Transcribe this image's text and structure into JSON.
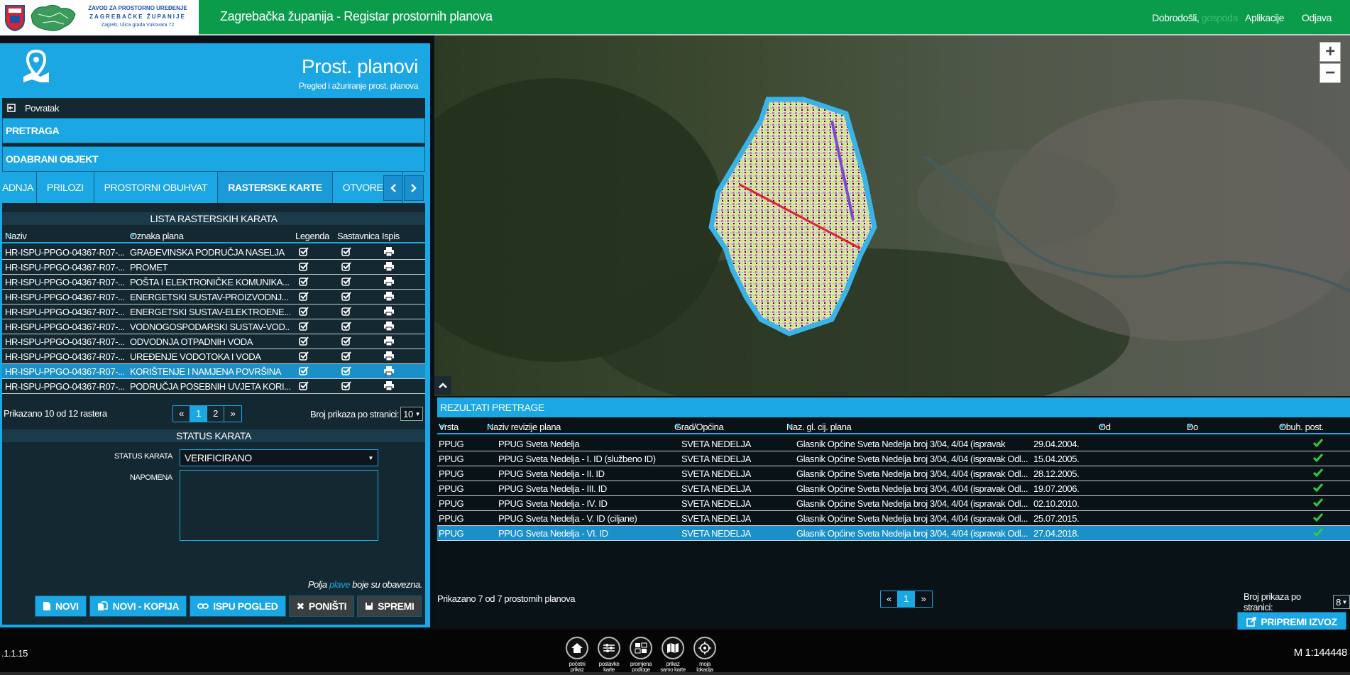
{
  "header": {
    "logo_line1": "ZAVOD ZA PROSTORNO UREĐENJE",
    "logo_line2": "ZAGREBAČKE ŽUPANIJE",
    "logo_line3": "Zagreb, Ulica grada Vukovara 72",
    "title": "Zagrebačka županija - Registar prostornih planova",
    "greeting": "Dobrodošli,",
    "user": "gospoda",
    "apps_link": "Aplikacije",
    "logout_link": "Odjava"
  },
  "left_panel": {
    "title": "Prost. planovi",
    "subtitle": "Pregled i ažuriranje prost. planova",
    "back_label": "Povratak",
    "search_section": "PRETRAGA",
    "selected_section": "ODABRANI OBJEKT",
    "tabs": [
      "ADNJA",
      "PRILOZI",
      "PROSTORNI OBUHVAT",
      "RASTERSKE KARTE",
      "OTVORENI"
    ],
    "active_tab": "RASTERSKE KARTE",
    "raster_list_title": "LISTA RASTERSKIH KARATA",
    "columns": [
      "Naziv",
      "Oznaka plana",
      "Legenda",
      "Sastavnica",
      "Ispis"
    ],
    "rows": [
      {
        "naziv": "HR-ISPU-PPGO-04367-R07-...",
        "oznaka": "GRAĐEVINSKA PODRUČJA NASELJA"
      },
      {
        "naziv": "HR-ISPU-PPGO-04367-R07-...",
        "oznaka": "PROMET"
      },
      {
        "naziv": "HR-ISPU-PPGO-04367-R07-...",
        "oznaka": "POŠTA I ELEKTRONIČKE KOMUNIKA..."
      },
      {
        "naziv": "HR-ISPU-PPGO-04367-R07-...",
        "oznaka": "ENERGETSKI SUSTAV-PROIZVODNJ..."
      },
      {
        "naziv": "HR-ISPU-PPGO-04367-R07-...",
        "oznaka": "ENERGETSKI SUSTAV-ELEKTROENE..."
      },
      {
        "naziv": "HR-ISPU-PPGO-04367-R07-...",
        "oznaka": "VODNOGOSPODARSKI SUSTAV-VOD..."
      },
      {
        "naziv": "HR-ISPU-PPGO-04367-R07-...",
        "oznaka": "ODVODNJA OTPADNIH VODA"
      },
      {
        "naziv": "HR-ISPU-PPGO-04367-R07-...",
        "oznaka": "UREĐENJE VODOTOKA I VODA"
      },
      {
        "naziv": "HR-ISPU-PPGO-04367-R07-...",
        "oznaka": "KORIŠTENJE I NAMJENA POVRŠINA"
      },
      {
        "naziv": "HR-ISPU-PPGO-04367-R07-...",
        "oznaka": "PODRUČJA POSEBNIH UVJETA KORI..."
      }
    ],
    "selected_row": 8,
    "shown_text": "Prikazano 10 od 12 rastera",
    "pager": [
      "«",
      "1",
      "2",
      "»"
    ],
    "per_page_label": "Broj prikaza po stranici:",
    "per_page_value": "10",
    "status_title": "STATUS KARATA",
    "status_label": "STATUS KARATA",
    "status_value": "VERIFICIRANO",
    "napomena_label": "NAPOMENA",
    "required_note_pre": "Polja",
    "required_note_blue": "plave",
    "required_note_post": "boje su obavezna.",
    "buttons": [
      "NOVI",
      "NOVI - KOPIJA",
      "ISPU POGLED",
      "PONIŠTI",
      "SPREMI"
    ]
  },
  "results": {
    "title": "REZULTATI PRETRAGE",
    "columns": [
      "Vrsta",
      "Naziv revizije plana",
      "Grad/Općina",
      "Naz. gl. cij. plana",
      "Od",
      "Do",
      "Obuh. post."
    ],
    "rows": [
      {
        "vrsta": "PPUG",
        "naziv": "PPUG Sveta Nedelja",
        "grad": "SVETA NEDELJA",
        "glasnik": "Glasnik Općine Sveta Nedelja broj 3/04, 4/04 (ispravak",
        "od": "29.04.2004."
      },
      {
        "vrsta": "PPUG",
        "naziv": "PPUG Sveta Nedelja - I. ID (službeno ID)",
        "grad": "SVETA NEDELJA",
        "glasnik": "Glasnik Općine Sveta Nedelja broj 3/04, 4/04 (ispravak Odl...",
        "od": "15.04.2005."
      },
      {
        "vrsta": "PPUG",
        "naziv": "PPUG Sveta Nedelja - II. ID",
        "grad": "SVETA NEDELJA",
        "glasnik": "Glasnik Općine Sveta Nedelja broj 3/04, 4/04 (ispravak Odl...",
        "od": "28.12.2005."
      },
      {
        "vrsta": "PPUG",
        "naziv": "PPUG Sveta Nedelja - III. ID",
        "grad": "SVETA NEDELJA",
        "glasnik": "Glasnik Općine Sveta Nedelja broj 3/04, 4/04 (ispravak Odl...",
        "od": "19.07.2006."
      },
      {
        "vrsta": "PPUG",
        "naziv": "PPUG Sveta Nedelja - IV. ID",
        "grad": "SVETA NEDELJA",
        "glasnik": "Glasnik Općine Sveta Nedelja broj 3/04, 4/04 (ispravak Odl...",
        "od": "02.10.2010."
      },
      {
        "vrsta": "PPUG",
        "naziv": "PPUG Sveta Nedelja - V. ID (ciljane)",
        "grad": "SVETA NEDELJA",
        "glasnik": "Glasnik Općine Sveta Nedelja broj 3/04, 4/04 (ispravak Odl...",
        "od": "25.07.2015."
      },
      {
        "vrsta": "PPUG",
        "naziv": "PPUG Sveta Nedelja - VI. ID",
        "grad": "SVETA NEDELJA",
        "glasnik": "Glasnik Općine Sveta Nedelja broj 3/04, 4/04 (ispravak Odl...",
        "od": "27.04.2018."
      }
    ],
    "selected_row": 6,
    "shown_text": "Prikazano 7 od 7 prostornih planova",
    "pager": [
      "«",
      "1",
      "»"
    ],
    "per_page_label": "Broj prikaza po stranici:",
    "per_page_value": "8",
    "prepare_button": "PRIPREMI IZVOZ"
  },
  "footer": {
    "version": ".1.1.15",
    "scale": "M 1:144448",
    "buttons": [
      {
        "label1": "početni",
        "label2": "prikaz",
        "icon": "home-icon"
      },
      {
        "label1": "postavke",
        "label2": "karte",
        "icon": "sliders-icon"
      },
      {
        "label1": "promjena",
        "label2": "podloge",
        "icon": "layers-icon"
      },
      {
        "label1": "prikaz",
        "label2": "samo karte",
        "icon": "map-icon"
      },
      {
        "label1": "moja",
        "label2": "lokacija",
        "icon": "crosshair-icon"
      }
    ]
  },
  "map": {
    "zoom_in": "+",
    "zoom_out": "−"
  },
  "colors": {
    "accent": "#1ba6e4",
    "header_green": "#0a9c4a",
    "check_green": "#2ecc40"
  }
}
